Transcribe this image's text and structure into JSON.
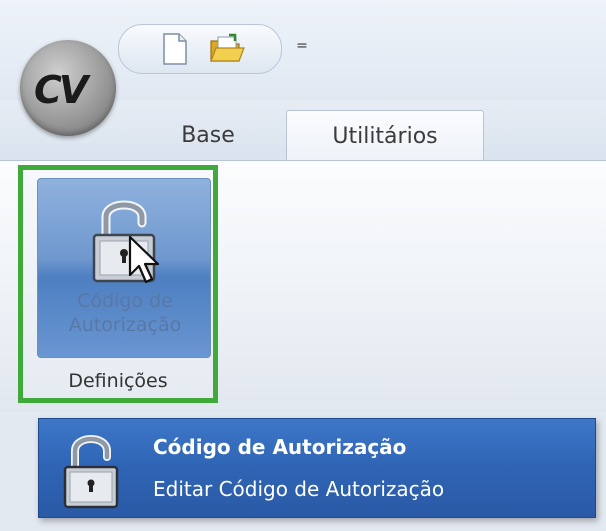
{
  "app": {
    "logo_text": "CV"
  },
  "quick_access": {
    "items": [
      {
        "icon": "new-document-icon"
      },
      {
        "icon": "open-folder-icon"
      }
    ],
    "customize_glyph": "="
  },
  "tabs": [
    {
      "label": "Base",
      "active": false
    },
    {
      "label": "Utilitários",
      "active": true
    }
  ],
  "ribbon": {
    "group": {
      "label": "Definições",
      "button": {
        "label": "Código de Autorização",
        "icon": "padlock-open-icon",
        "state": "hover"
      }
    }
  },
  "tooltip": {
    "title": "Código de Autorização",
    "description": "Editar Código de Autorização",
    "icon": "padlock-open-icon"
  },
  "colors": {
    "highlight_border": "#3faa3a",
    "tooltip_bg": "#2f64b4",
    "button_hover": "#6f98cf"
  }
}
